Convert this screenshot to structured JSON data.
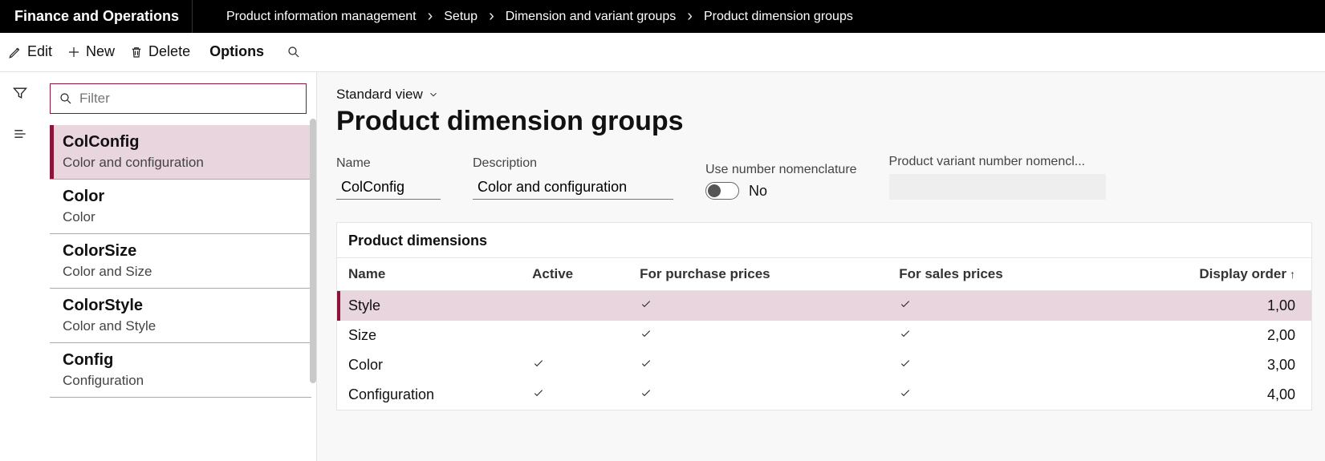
{
  "app_title": "Finance and Operations",
  "breadcrumbs": [
    "Product information management",
    "Setup",
    "Dimension and variant groups",
    "Product dimension groups"
  ],
  "toolbar": {
    "edit": "Edit",
    "new": "New",
    "delete": "Delete",
    "options": "Options"
  },
  "nav": {
    "filter_placeholder": "Filter",
    "items": [
      {
        "title": "ColConfig",
        "desc": "Color and configuration",
        "selected": true
      },
      {
        "title": "Color",
        "desc": "Color"
      },
      {
        "title": "ColorSize",
        "desc": "Color and Size"
      },
      {
        "title": "ColorStyle",
        "desc": "Color and Style"
      },
      {
        "title": "Config",
        "desc": "Configuration"
      }
    ]
  },
  "view_label": "Standard view",
  "page_title": "Product dimension groups",
  "fields": {
    "name_label": "Name",
    "name_value": "ColConfig",
    "desc_label": "Description",
    "desc_value": "Color and configuration",
    "toggle_label": "Use number nomenclature",
    "toggle_value": "No",
    "nomen_label": "Product variant number nomencl..."
  },
  "grid": {
    "title": "Product dimensions",
    "columns": [
      "Name",
      "Active",
      "For purchase prices",
      "For sales prices",
      "Display order"
    ],
    "sort_column": 4,
    "sort_dir": "asc",
    "rows": [
      {
        "name": "Style",
        "active": false,
        "purchase": true,
        "sales": true,
        "order": "1,00",
        "selected": true
      },
      {
        "name": "Size",
        "active": false,
        "purchase": true,
        "sales": true,
        "order": "2,00"
      },
      {
        "name": "Color",
        "active": true,
        "purchase": true,
        "sales": true,
        "order": "3,00"
      },
      {
        "name": "Configuration",
        "active": true,
        "purchase": true,
        "sales": true,
        "order": "4,00"
      }
    ]
  }
}
